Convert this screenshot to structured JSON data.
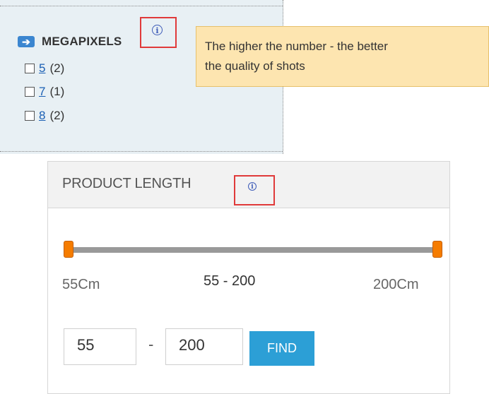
{
  "megapixels": {
    "title": "MEGAPIXELS",
    "info_glyph": "i",
    "options": [
      {
        "value": "5",
        "count": "(2)"
      },
      {
        "value": "7",
        "count": "(1)"
      },
      {
        "value": "8",
        "count": "(2)"
      }
    ],
    "tooltip_lines": [
      "The higher the number - the better",
      "the quality of shots"
    ]
  },
  "product_length": {
    "title": "PRODUCT LENGTH",
    "info_glyph": "i",
    "min_label": "55Cm",
    "range_label": "55 -  200",
    "max_label": "200Cm",
    "min_value": "55",
    "max_value": "200",
    "separator": "-",
    "find_label": "FIND",
    "slider": {
      "low": 55,
      "high": 200
    }
  },
  "colors": {
    "accent": "#2c9fd6",
    "handle": "#f57c00",
    "tooltip_bg": "#fde5b0",
    "panel_bg": "#e8f0f4",
    "highlight_red": "#e03a3a"
  },
  "icons": [
    "arrow-right-icon",
    "info-icon"
  ]
}
